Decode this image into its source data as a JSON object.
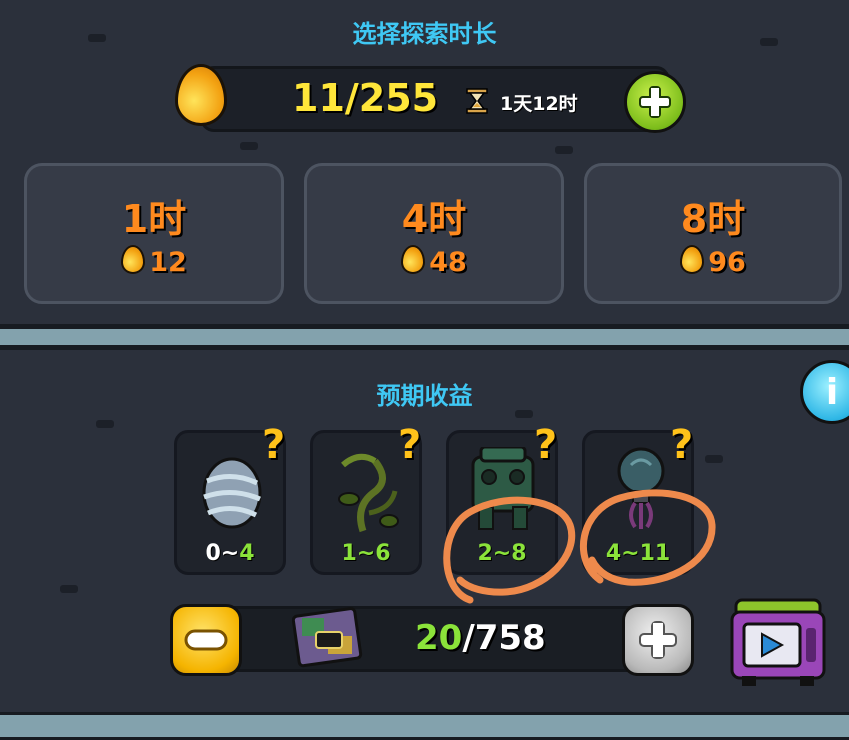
{
  "header": {
    "title": "选择探索时长"
  },
  "resource": {
    "current": "11/255",
    "timer": "1天12时",
    "icon": "oil-drop-icon"
  },
  "duration_options": [
    {
      "label": "1时",
      "cost": "12"
    },
    {
      "label": "4时",
      "cost": "48"
    },
    {
      "label": "8时",
      "cost": "96"
    }
  ],
  "rewards": {
    "title": "预期收益",
    "items": [
      {
        "icon": "striped-egg-icon",
        "min": "0",
        "sep": "~",
        "max": "4",
        "unknown": "?"
      },
      {
        "icon": "vine-plant-icon",
        "min": "1",
        "sep": "~",
        "max": "6",
        "unknown": "?"
      },
      {
        "icon": "green-machine-monster-icon",
        "min": "2",
        "sep": "~",
        "max": "8",
        "unknown": "?"
      },
      {
        "icon": "lightbulb-jellyfish-icon",
        "min": "4",
        "sep": "~",
        "max": "11",
        "unknown": "?"
      }
    ]
  },
  "explorer_count": {
    "current": "20",
    "total": "/758"
  },
  "colors": {
    "accent_title": "#3fc8f4",
    "cost_orange": "#ff8a1e",
    "value_yellow": "#ffe63a",
    "reward_green": "#8be33a",
    "annotation": "#ee8a4c"
  }
}
